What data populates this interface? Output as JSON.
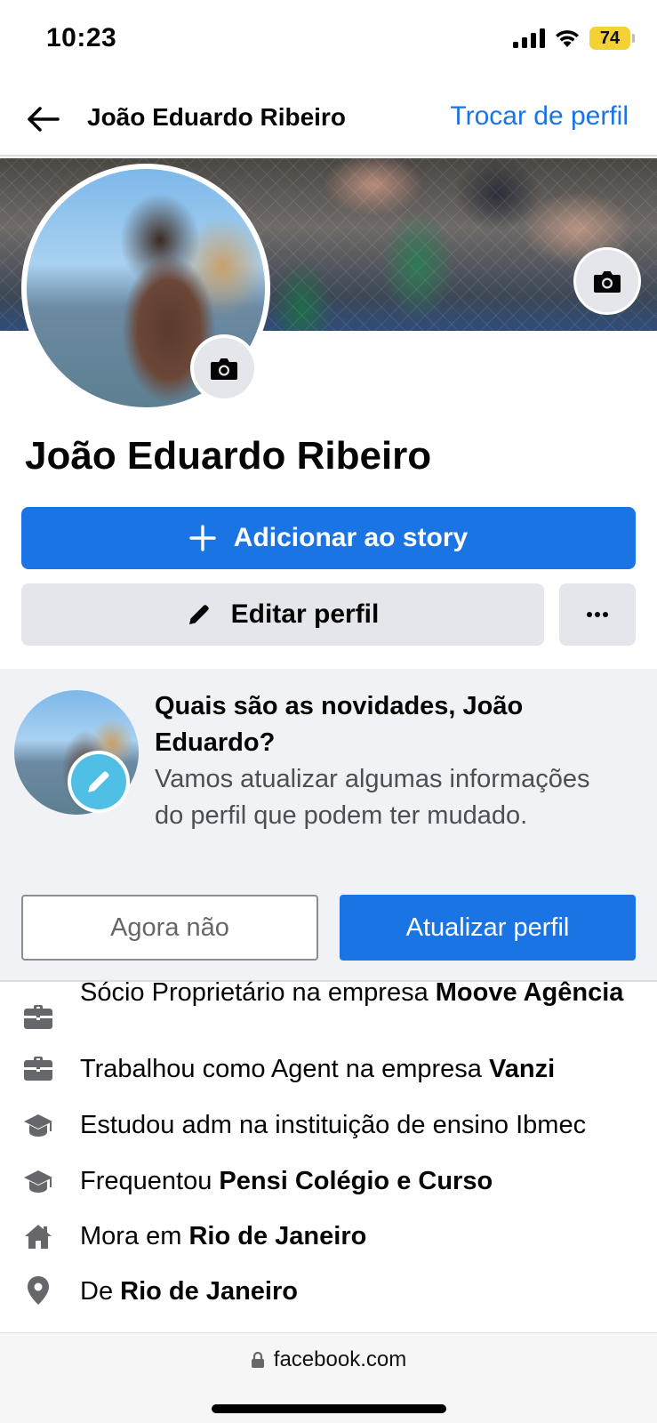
{
  "status_bar": {
    "time": "10:23",
    "battery": "74"
  },
  "header": {
    "title": "João Eduardo Ribeiro",
    "switch_profile": "Trocar de perfil"
  },
  "profile": {
    "name": "João Eduardo Ribeiro",
    "add_story": "Adicionar ao story",
    "edit_profile": "Editar perfil"
  },
  "prompt": {
    "title": "Quais são as novidades, João Eduardo?",
    "body": "Vamos atualizar algumas informações do perfil que podem ter mudado.",
    "not_now": "Agora não",
    "update": "Atualizar perfil"
  },
  "details": [
    {
      "icon": "briefcase-icon",
      "prefix": "Sócio Proprietário na empresa ",
      "bold": "Moove Agência"
    },
    {
      "icon": "briefcase-icon",
      "prefix": "Trabalhou como Agent na empresa ",
      "bold": "Vanzi"
    },
    {
      "icon": "graduation-cap-icon",
      "prefix": "Estudou adm na instituição de ensino Ibmec",
      "bold": ""
    },
    {
      "icon": "graduation-cap-icon",
      "prefix": "Frequentou ",
      "bold": "Pensi Colégio e Curso"
    },
    {
      "icon": "home-icon",
      "prefix": "Mora em ",
      "bold": "Rio de Janeiro"
    },
    {
      "icon": "location-pin-icon",
      "prefix": "De ",
      "bold": "Rio de Janeiro"
    }
  ],
  "browser": {
    "url": "facebook.com"
  },
  "colors": {
    "accent": "#1b74e4",
    "secondary_button": "#e4e6eb",
    "card_background": "#f0f2f5"
  }
}
